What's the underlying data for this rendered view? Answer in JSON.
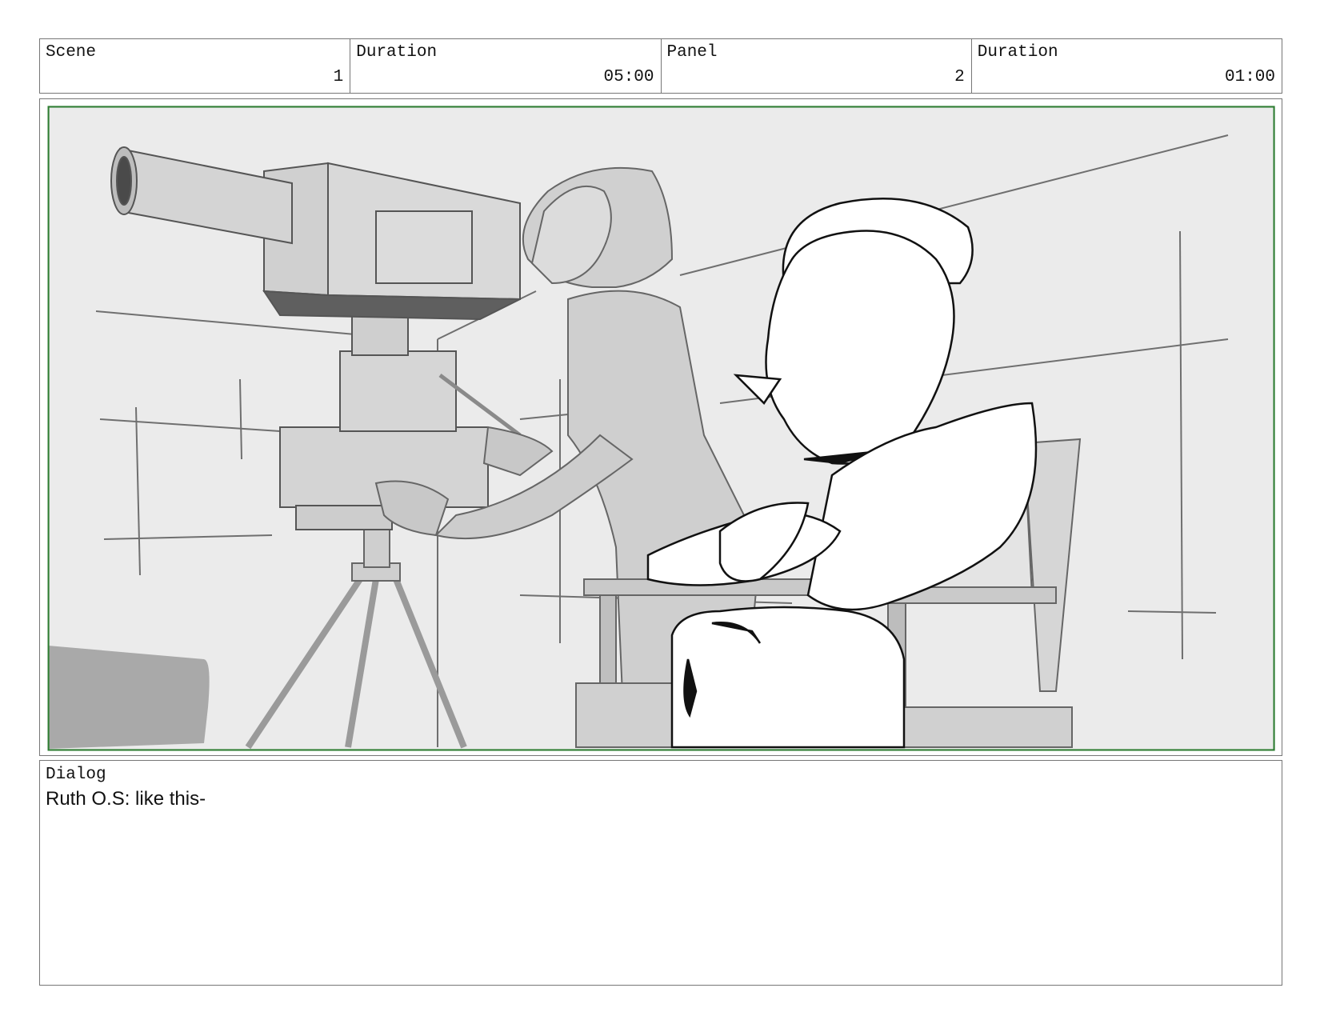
{
  "header": {
    "cells": [
      {
        "label": "Scene",
        "value": "1"
      },
      {
        "label": "Duration",
        "value": "05:00"
      },
      {
        "label": "Panel",
        "value": "2"
      },
      {
        "label": "Duration",
        "value": "01:00"
      }
    ]
  },
  "panel": {
    "safe_area_color": "#2e7d32",
    "background_color": "#ebebeb"
  },
  "dialog": {
    "label": "Dialog",
    "text": "Ruth O.S: like this-"
  }
}
